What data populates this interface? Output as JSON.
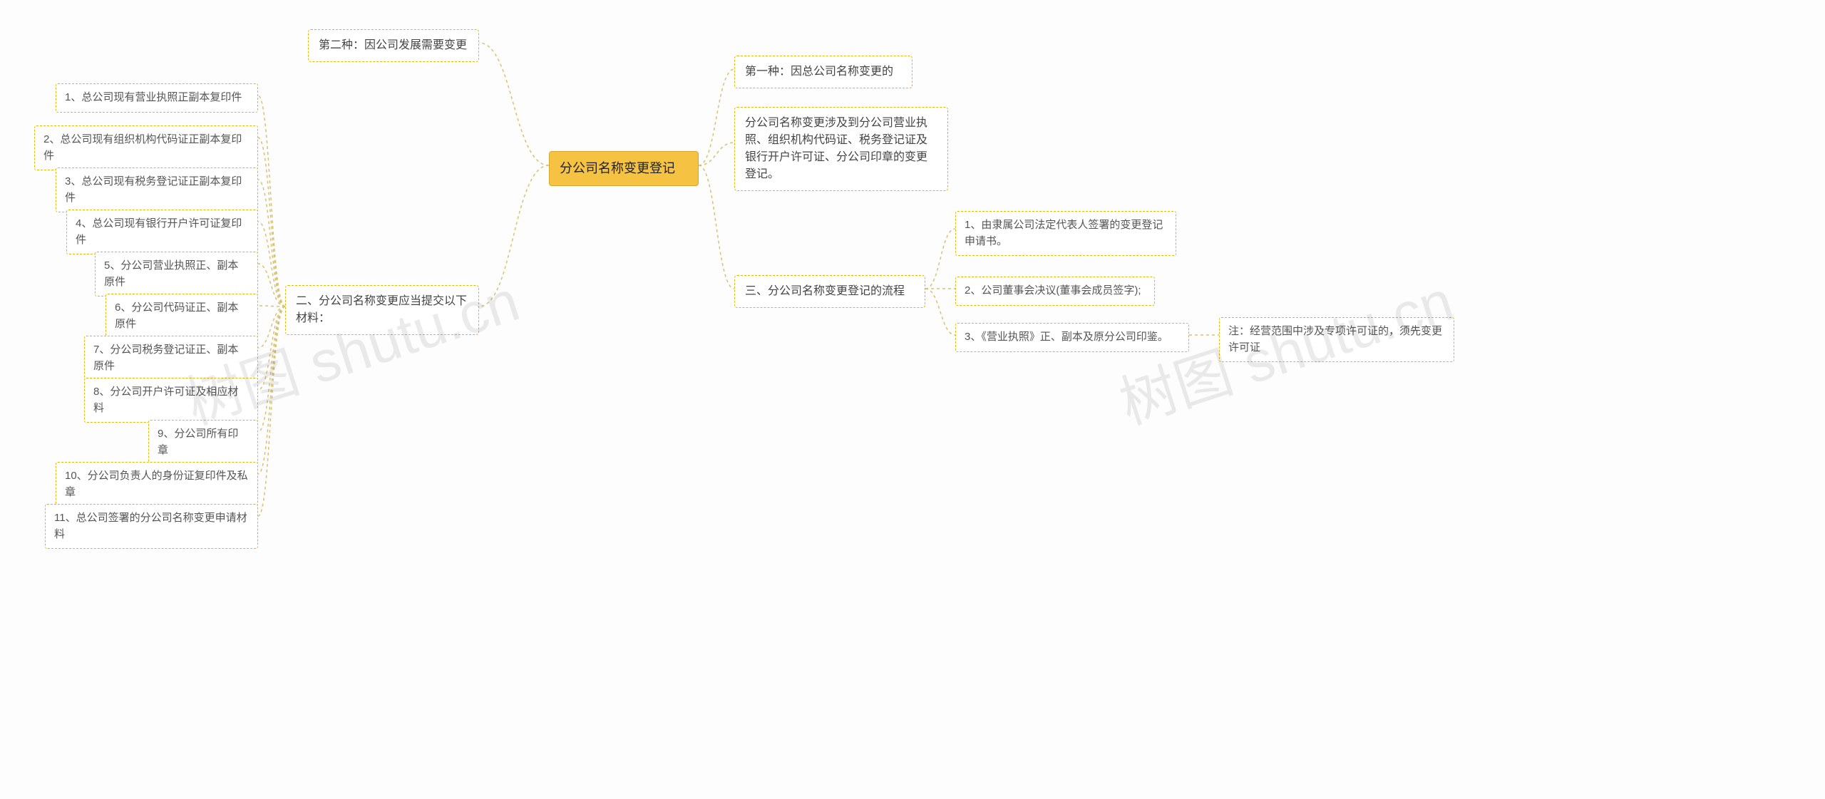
{
  "root": {
    "title": "分公司名称变更登记"
  },
  "right": {
    "b1": {
      "label": "第一种：因总公司名称变更的"
    },
    "b2": {
      "label": "分公司名称变更涉及到分公司营业执照、组织机构代码证、税务登记证及银行开户许可证、分公司印章的变更登记。"
    },
    "b3": {
      "label": "三、分公司名称变更登记的流程",
      "c1": "1、由隶属公司法定代表人签署的变更登记申请书。",
      "c2": "2、公司董事会决议(董事会成员签字);",
      "c3": "3、《营业执照》正、副本及原分公司印鉴。",
      "c3note": "注：经营范围中涉及专项许可证的，须先变更许可证"
    }
  },
  "left": {
    "b1": {
      "label": "第二种：因公司发展需要变更"
    },
    "b2": {
      "label": "二、分公司名称变更应当提交以下材料：",
      "items": [
        "1、总公司现有营业执照正副本复印件",
        "2、总公司现有组织机构代码证正副本复印件",
        "3、总公司现有税务登记证正副本复印件",
        "4、总公司现有银行开户许可证复印件",
        "5、分公司营业执照正、副本原件",
        "6、分公司代码证正、副本原件",
        "7、分公司税务登记证正、副本原件",
        "8、分公司开户许可证及相应材料",
        "9、分公司所有印章",
        "10、分公司负责人的身份证复印件及私章",
        "11、总公司签署的分公司名称变更申请材料"
      ]
    }
  },
  "watermark": "树图 shutu.cn"
}
